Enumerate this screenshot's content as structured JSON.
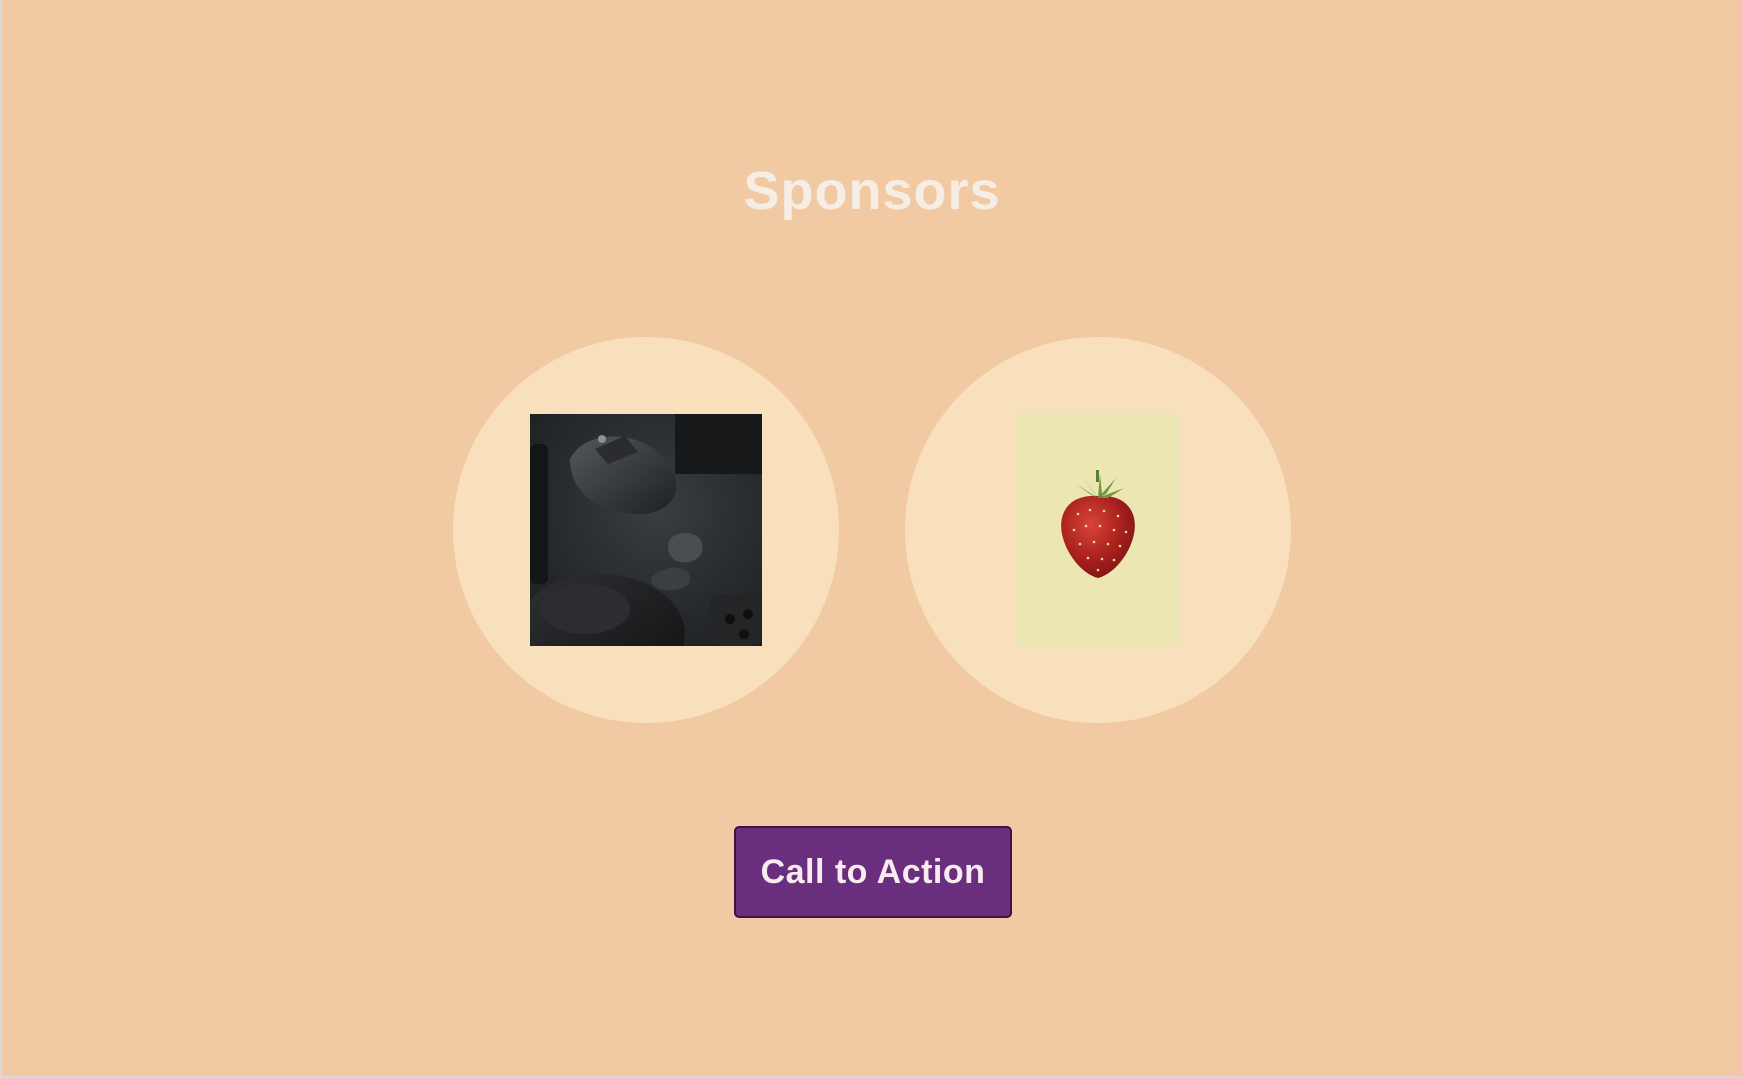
{
  "section": {
    "title": "Sponsors"
  },
  "sponsors": [
    {
      "id": "sponsor-1",
      "image_desc": "tech-accessories-photo"
    },
    {
      "id": "sponsor-2",
      "image_desc": "strawberry-photo"
    }
  ],
  "cta": {
    "label": "Call to Action"
  },
  "colors": {
    "background": "#f1caa3",
    "circle": "#f8e0bd",
    "title": "#f6ede4",
    "button_bg": "#6a2e7f",
    "button_border": "#3c1247",
    "button_text": "#f8ecef",
    "berry_bg": "#ece6b3"
  }
}
